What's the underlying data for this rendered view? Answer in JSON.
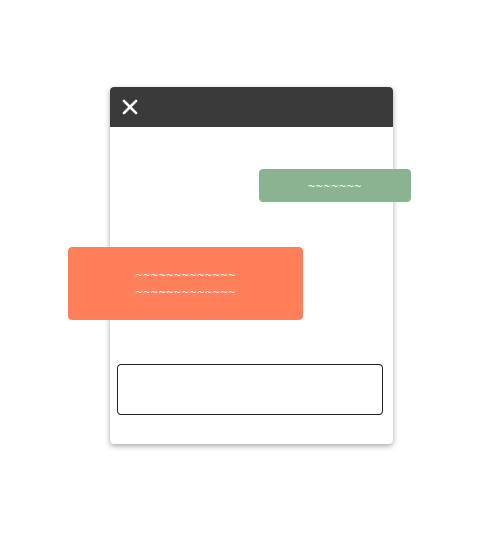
{
  "window": {
    "header_color": "#3a3a3a",
    "close_icon": "close-icon"
  },
  "messages": {
    "sent": {
      "text": "~~~~~~~",
      "color": "#8ab392"
    },
    "received": {
      "lines": [
        "~~~~~~~~~~~~~",
        "~~~~~~~~~~~~~"
      ],
      "color": "#ff7f5a"
    }
  },
  "input": {
    "value": "",
    "placeholder": ""
  }
}
